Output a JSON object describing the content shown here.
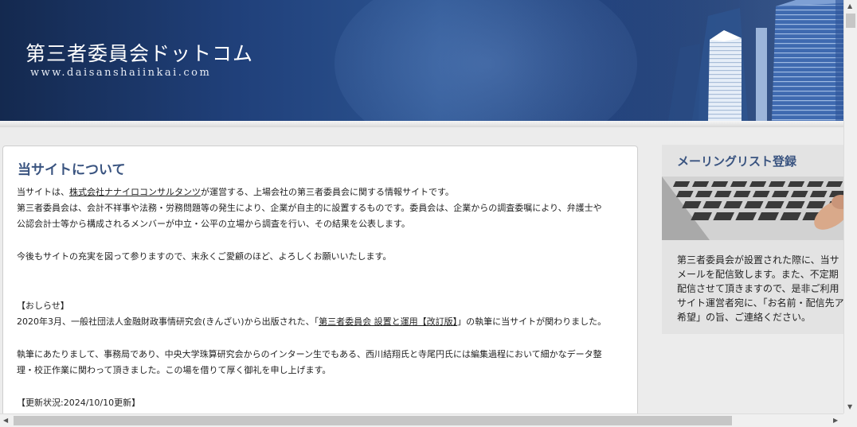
{
  "header": {
    "title": "第三者委員会ドットコム",
    "url": "www.daisanshaiinkai.com"
  },
  "main": {
    "heading": "当サイトについて",
    "intro_prefix": "当サイトは、",
    "intro_link": "株式会社ナナイロコンサルタンツ",
    "intro_suffix": "が運営する、上場会社の第三者委員会に関する情報サイトです。",
    "para1_line2": "第三者委員会は、会計不祥事や法務・労務問題等の発生により、企業が自主的に設置するものです。委員会は、企業からの調査委嘱により、弁護士や",
    "para1_line3": "公認会計士等から構成されるメンバーが中立・公平の立場から調査を行い、その結果を公表します。",
    "para2": "今後もサイトの充実を図って参りますので、末永くご愛顧のほど、よろしくお願いいたします。",
    "news_heading": "【おしらせ】",
    "news_prefix": "2020年3月、一般社団法人金融財政事情研究会(きんざい)から出版された、「",
    "news_link": "第三者委員会 設置と運用【改訂版】",
    "news_suffix": "」の執筆に当サイトが関わりました。",
    "thanks_line1": "執筆にあたりまして、事務局であり、中央大学珠算研究会からのインターン生でもある、西川結翔氏と寺尾円氏には編集過程において細かなデータ整",
    "thanks_line2": "理・校正作業に関わって頂きました。この場を借りて厚く御礼を申し上げます。",
    "update_status": "【更新状況:2024/10/10更新】"
  },
  "sidebar": {
    "heading": "メーリングリスト登録",
    "photo_icon": "keyboard-photo",
    "lines": [
      "第三者委員会が設置された際に、当サ",
      "メールを配信致します。また、不定期",
      "配信させて頂きますので、是非ご利用",
      "サイト運営者宛に、「お名前・配信先ア",
      "希望」の旨、ご連絡ください。"
    ]
  },
  "colors": {
    "banner": "#20407a",
    "heading": "#3a5480",
    "sidebar_bg": "#e3e3e3"
  }
}
